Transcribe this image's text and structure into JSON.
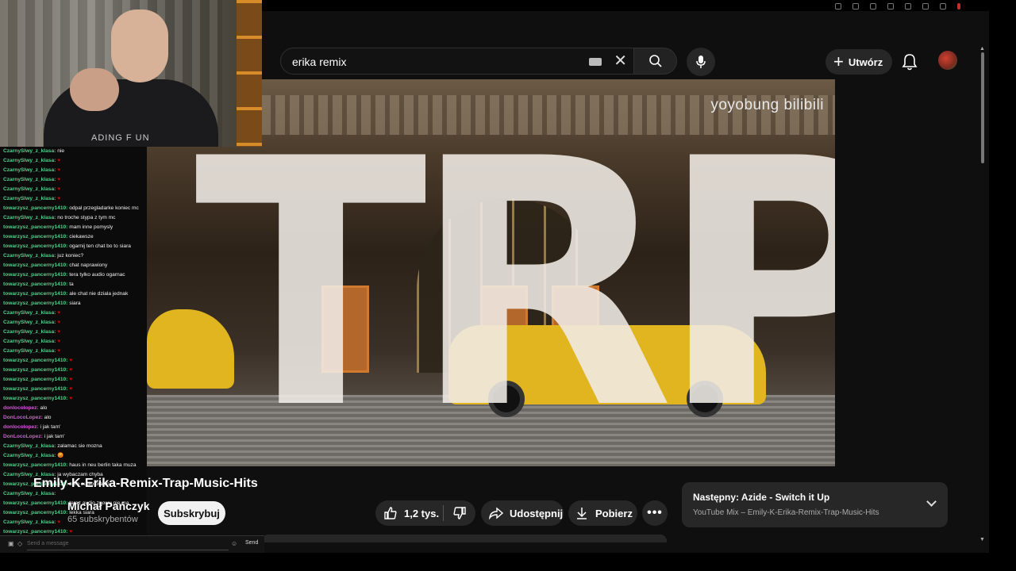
{
  "search": {
    "query": "erika remix"
  },
  "header": {
    "create_label": "Utwórz"
  },
  "video": {
    "watermark": "yoyobung bilibili",
    "overlay_text": "TRP",
    "title": "Emily-K-Erika-Remix-Trap-Music-Hits"
  },
  "channel": {
    "name": "Michał Pańczyk",
    "subscribers": "65 subskrybentów",
    "subscribe_label": "Subskrybuj"
  },
  "actions": {
    "likes": "1,2 tys.",
    "share_label": "Udostępnij",
    "download_label": "Pobierz",
    "more_label": "•••"
  },
  "next": {
    "prefix": "Następny:",
    "title": "Azide - Switch it Up",
    "subtitle": "YouTube Mix – Emily-K-Erika-Remix-Trap-Music-Hits"
  },
  "webcam": {
    "shirt_text": "ADING F UN"
  },
  "chat": {
    "messages": [
      {
        "user": "CzarnySlwy_z_klasa:",
        "text": "nie"
      },
      {
        "user": "CzarnySlwy_z_klasa:",
        "text": "♥"
      },
      {
        "user": "CzarnySlwy_z_klasa:",
        "text": "♥"
      },
      {
        "user": "CzarnySlwy_z_klasa:",
        "text": "♥"
      },
      {
        "user": "CzarnySlwy_z_klasa:",
        "text": "♥"
      },
      {
        "user": "CzarnySlwy_z_klasa:",
        "text": "♥"
      },
      {
        "user": "towarzysz_pancerny1410:",
        "text": "odpal przegladarke koniec mc"
      },
      {
        "user": "CzarnySlwy_z_klasa:",
        "text": "no troche stypa z tym mc"
      },
      {
        "user": "towarzysz_pancerny1410:",
        "text": "mam inne pomysly"
      },
      {
        "user": "towarzysz_pancerny1410:",
        "text": "ciekawsze"
      },
      {
        "user": "towarzysz_pancerny1410:",
        "text": "ogarnij ten chat bo to siara"
      },
      {
        "user": "CzarnySlwy_z_klasa:",
        "text": "juz koniec?"
      },
      {
        "user": "towarzysz_pancerny1410:",
        "text": "chat naprawiony"
      },
      {
        "user": "towarzysz_pancerny1410:",
        "text": "tera tylko audio ogarnac"
      },
      {
        "user": "towarzysz_pancerny1410:",
        "text": "ta"
      },
      {
        "user": "towarzysz_pancerny1410:",
        "text": "ale chat nie dziala jednak"
      },
      {
        "user": "towarzysz_pancerny1410:",
        "text": "siara"
      },
      {
        "user": "CzarnySlwy_z_klasa:",
        "text": "♥"
      },
      {
        "user": "CzarnySlwy_z_klasa:",
        "text": "♥"
      },
      {
        "user": "CzarnySlwy_z_klasa:",
        "text": "♥"
      },
      {
        "user": "CzarnySlwy_z_klasa:",
        "text": "♥"
      },
      {
        "user": "CzarnySlwy_z_klasa:",
        "text": "♥"
      },
      {
        "user": "towarzysz_pancerny1410:",
        "text": "♥"
      },
      {
        "user": "towarzysz_pancerny1410:",
        "text": "♥"
      },
      {
        "user": "towarzysz_pancerny1410:",
        "text": "♥"
      },
      {
        "user": "towarzysz_pancerny1410:",
        "text": "♥"
      },
      {
        "user": "towarzysz_pancerny1410:",
        "text": "♥"
      },
      {
        "user": "donlocolopez:",
        "text": "alo",
        "pink": true
      },
      {
        "user": "DonLocoLopez:",
        "text": "alo",
        "pink": true
      },
      {
        "user": "donlocolopez:",
        "text": "i jak tam'",
        "pink": true
      },
      {
        "user": "DonLocoLopez:",
        "text": "i jak tam'",
        "pink": true
      },
      {
        "user": "CzarnySlwy_z_klasa:",
        "text": "zalamac sie mozna"
      },
      {
        "user": "CzarnySlwy_z_klasa:",
        "text": "😡"
      },
      {
        "user": "towarzysz_pancerny1410:",
        "text": "haus in neu berlin taka muza"
      },
      {
        "user": "CzarnySlwy_z_klasa:",
        "text": "ja wybaczam chyba"
      },
      {
        "user": "towarzysz_pancerny1410:",
        "text": "zero audio brawo"
      },
      {
        "user": "CzarnySlwy_z_klasa:",
        "text": ""
      },
      {
        "user": "towarzysz_pancerny1410:",
        "text": "teraz audio znowu nie ma"
      },
      {
        "user": "towarzysz_pancerny1410:",
        "text": "lekka siara"
      },
      {
        "user": "CzarnySlwy_z_klasa:",
        "text": "♥"
      },
      {
        "user": "towarzysz_pancerny1410:",
        "text": "♥"
      },
      {
        "user": "towarzysz_pancerny1410:",
        "text": "♥"
      }
    ],
    "input_placeholder": "Send a message",
    "send_label": "Send"
  }
}
